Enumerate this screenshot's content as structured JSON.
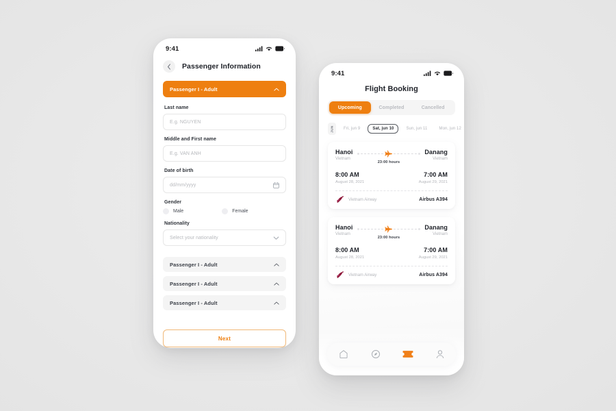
{
  "canvas": {
    "background": "#e8e8e8",
    "accent": "#ee7f10"
  },
  "left_phone": {
    "status": {
      "time": "9:41",
      "signal_icon": "cellular-signal-icon",
      "wifi_icon": "wifi-icon",
      "battery_icon": "battery-icon"
    },
    "header": {
      "back_icon": "chevron-left-icon",
      "title": "Passenger Information"
    },
    "open_accordion": {
      "label": "Passenger I - Adult",
      "chevron_icon": "chevron-up-icon"
    },
    "fields": [
      {
        "label": "Last name",
        "placeholder": "E.g. NGUYEN",
        "value": "",
        "trailing_icon": ""
      },
      {
        "label": "Middle and First name",
        "placeholder": "E.g. VAN ANH",
        "value": "",
        "trailing_icon": ""
      },
      {
        "label": "Date of birth",
        "placeholder": "dd/mm/yyyy",
        "value": "",
        "trailing_icon": "calendar-icon"
      }
    ],
    "gender": {
      "label": "Gender",
      "options": [
        {
          "label": "Male",
          "selected": false
        },
        {
          "label": "Female",
          "selected": false
        }
      ]
    },
    "nationality": {
      "label": "Nationality",
      "placeholder": "Select your nationality",
      "chevron_icon": "chevron-down-icon"
    },
    "closed_accordions": [
      {
        "label": "Passenger I - Adult",
        "chevron_icon": "chevron-up-icon"
      },
      {
        "label": "Passenger I - Adult",
        "chevron_icon": "chevron-up-icon"
      },
      {
        "label": "Passenger I - Adult",
        "chevron_icon": "chevron-up-icon"
      }
    ],
    "next_button": {
      "label": "Next"
    }
  },
  "right_phone": {
    "status": {
      "time": "9:41",
      "signal_icon": "cellular-signal-icon",
      "wifi_icon": "wifi-icon",
      "battery_icon": "battery-icon"
    },
    "title": "Flight Booking",
    "tabs": [
      {
        "label": "Upcoming",
        "active": true
      },
      {
        "label": "Completed",
        "active": false
      },
      {
        "label": "Cancelled",
        "active": false
      }
    ],
    "month_chip": "JUN",
    "dates": [
      {
        "label": "Fri, jun 9",
        "selected": false
      },
      {
        "label": "Sat, jun 10",
        "selected": true
      },
      {
        "label": "Sun, jun 11",
        "selected": false
      },
      {
        "label": "Mon, jun 12",
        "selected": false
      }
    ],
    "flights": [
      {
        "from_city": "Hanoi",
        "from_country": "Vietnam",
        "to_city": "Danang",
        "to_country": "Vietnam",
        "duration": "23:00 hours",
        "plane_icon": "airplane-icon",
        "depart_time": "8:00 AM",
        "depart_date": "August 28, 2021",
        "arrive_time": "7:00 AM",
        "arrive_date": "August 29, 2021",
        "airline_logo_icon": "vietnam-airway-logo-icon",
        "airline": "Vietnam Airway",
        "aircraft": "Airbus A394"
      },
      {
        "from_city": "Hanoi",
        "from_country": "Vietnam",
        "to_city": "Danang",
        "to_country": "Vietnam",
        "duration": "23:00 hours",
        "plane_icon": "airplane-icon",
        "depart_time": "8:00 AM",
        "depart_date": "August 28, 2021",
        "arrive_time": "7:00 AM",
        "arrive_date": "August 29, 2021",
        "airline_logo_icon": "vietnam-airway-logo-icon",
        "airline": "Vietnam Airway",
        "aircraft": "Airbus A394"
      }
    ],
    "tabbar": [
      {
        "icon": "home-icon",
        "active": false
      },
      {
        "icon": "compass-icon",
        "active": false
      },
      {
        "icon": "ticket-icon",
        "active": true
      },
      {
        "icon": "person-icon",
        "active": false
      }
    ]
  }
}
